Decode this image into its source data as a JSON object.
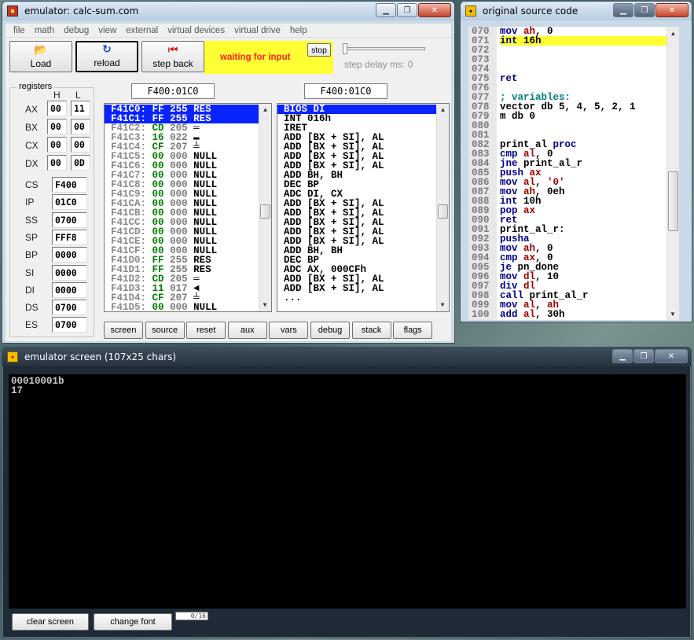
{
  "emulator_window": {
    "title": "emulator: calc-sum.com",
    "menu": [
      "file",
      "math",
      "debug",
      "view",
      "external",
      "virtual devices",
      "virtual drive",
      "help"
    ],
    "toolbar": {
      "load": "Load",
      "reload": "reload",
      "step_back": "step back",
      "status": "waiting for input",
      "stop": "stop",
      "step_delay": "step delay ms: 0"
    },
    "registers": {
      "title": "registers",
      "h": "H",
      "l": "L",
      "split": [
        {
          "name": "AX",
          "h": "00",
          "l": "11"
        },
        {
          "name": "BX",
          "h": "00",
          "l": "00"
        },
        {
          "name": "CX",
          "h": "00",
          "l": "00"
        },
        {
          "name": "DX",
          "h": "00",
          "l": "0D"
        }
      ],
      "full": [
        {
          "name": "CS",
          "value": "F400"
        },
        {
          "name": "IP",
          "value": "01C0"
        },
        {
          "name": "SS",
          "value": "0700"
        },
        {
          "name": "SP",
          "value": "FFF8"
        },
        {
          "name": "BP",
          "value": "0000"
        },
        {
          "name": "SI",
          "value": "0000"
        },
        {
          "name": "DI",
          "value": "0000"
        },
        {
          "name": "DS",
          "value": "0700"
        },
        {
          "name": "ES",
          "value": "0700"
        }
      ]
    },
    "memory_address": "F400:01C0",
    "disasm_address": "F400:01C0",
    "memory": [
      {
        "addr": "F41C0:",
        "hex": "FF",
        "dec": "255",
        "chr": "RES",
        "sel": true
      },
      {
        "addr": "F41C1:",
        "hex": "FF",
        "dec": "255",
        "chr": "RES",
        "sel": true
      },
      {
        "addr": "F41C2:",
        "hex": "CD",
        "dec": "205",
        "chr": "═"
      },
      {
        "addr": "F41C3:",
        "hex": "16",
        "dec": "022",
        "chr": "▬"
      },
      {
        "addr": "F41C4:",
        "hex": "CF",
        "dec": "207",
        "chr": "╧"
      },
      {
        "addr": "F41C5:",
        "hex": "00",
        "dec": "000",
        "chr": "NULL"
      },
      {
        "addr": "F41C6:",
        "hex": "00",
        "dec": "000",
        "chr": "NULL"
      },
      {
        "addr": "F41C7:",
        "hex": "00",
        "dec": "000",
        "chr": "NULL"
      },
      {
        "addr": "F41C8:",
        "hex": "00",
        "dec": "000",
        "chr": "NULL"
      },
      {
        "addr": "F41C9:",
        "hex": "00",
        "dec": "000",
        "chr": "NULL"
      },
      {
        "addr": "F41CA:",
        "hex": "00",
        "dec": "000",
        "chr": "NULL"
      },
      {
        "addr": "F41CB:",
        "hex": "00",
        "dec": "000",
        "chr": "NULL"
      },
      {
        "addr": "F41CC:",
        "hex": "00",
        "dec": "000",
        "chr": "NULL"
      },
      {
        "addr": "F41CD:",
        "hex": "00",
        "dec": "000",
        "chr": "NULL"
      },
      {
        "addr": "F41CE:",
        "hex": "00",
        "dec": "000",
        "chr": "NULL"
      },
      {
        "addr": "F41CF:",
        "hex": "00",
        "dec": "000",
        "chr": "NULL"
      },
      {
        "addr": "F41D0:",
        "hex": "FF",
        "dec": "255",
        "chr": "RES"
      },
      {
        "addr": "F41D1:",
        "hex": "FF",
        "dec": "255",
        "chr": "RES"
      },
      {
        "addr": "F41D2:",
        "hex": "CD",
        "dec": "205",
        "chr": "═"
      },
      {
        "addr": "F41D3:",
        "hex": "11",
        "dec": "017",
        "chr": "◄"
      },
      {
        "addr": "F41D4:",
        "hex": "CF",
        "dec": "207",
        "chr": "╧"
      },
      {
        "addr": "F41D5:",
        "hex": "00",
        "dec": "000",
        "chr": "NULL"
      }
    ],
    "disasm": [
      {
        "text": "BIOS DI",
        "sel": true
      },
      {
        "text": "INT 016h"
      },
      {
        "text": "IRET"
      },
      {
        "text": "ADD [BX + SI], AL"
      },
      {
        "text": "ADD [BX + SI], AL"
      },
      {
        "text": "ADD [BX + SI], AL"
      },
      {
        "text": "ADD [BX + SI], AL"
      },
      {
        "text": "ADD BH, BH"
      },
      {
        "text": "DEC BP"
      },
      {
        "text": "ADC DI, CX"
      },
      {
        "text": "ADD [BX + SI], AL"
      },
      {
        "text": "ADD [BX + SI], AL"
      },
      {
        "text": "ADD [BX + SI], AL"
      },
      {
        "text": "ADD [BX + SI], AL"
      },
      {
        "text": "ADD [BX + SI], AL"
      },
      {
        "text": "ADD BH, BH"
      },
      {
        "text": "DEC BP"
      },
      {
        "text": "ADC AX, 000CFh"
      },
      {
        "text": "ADD [BX + SI], AL"
      },
      {
        "text": "ADD [BX + SI], AL"
      },
      {
        "text": "..."
      }
    ],
    "bottom_buttons": [
      "screen",
      "source",
      "reset",
      "aux",
      "vars",
      "debug",
      "stack",
      "flags"
    ]
  },
  "source_window": {
    "title": "original source code",
    "lines": [
      {
        "n": "070",
        "parts": [
          [
            "kw",
            "mov "
          ],
          [
            "rg",
            "ah"
          ],
          [
            "nm",
            ", 0"
          ]
        ]
      },
      {
        "n": "071",
        "parts": [
          [
            "kw",
            "int "
          ],
          [
            "nm",
            "16h"
          ]
        ],
        "hl": true
      },
      {
        "n": "072",
        "parts": []
      },
      {
        "n": "073",
        "parts": []
      },
      {
        "n": "074",
        "parts": []
      },
      {
        "n": "075",
        "parts": [
          [
            "kw",
            "ret"
          ]
        ]
      },
      {
        "n": "076",
        "parts": []
      },
      {
        "n": "077",
        "parts": [
          [
            "cm",
            "; variables:"
          ]
        ]
      },
      {
        "n": "078",
        "parts": [
          [
            "nm",
            "vector db 5, 4, 5, 2, 1"
          ]
        ]
      },
      {
        "n": "079",
        "parts": [
          [
            "nm",
            "m db 0"
          ]
        ]
      },
      {
        "n": "080",
        "parts": []
      },
      {
        "n": "081",
        "parts": []
      },
      {
        "n": "082",
        "parts": [
          [
            "nm",
            "print_al "
          ],
          [
            "kw",
            "proc"
          ]
        ]
      },
      {
        "n": "083",
        "parts": [
          [
            "kw",
            "cmp "
          ],
          [
            "rg",
            "al"
          ],
          [
            "nm",
            ", 0"
          ]
        ]
      },
      {
        "n": "084",
        "parts": [
          [
            "kw",
            "jne "
          ],
          [
            "nm",
            "print_al_r"
          ]
        ]
      },
      {
        "n": "085",
        "parts": [
          [
            "kw",
            "push "
          ],
          [
            "rg",
            "ax"
          ]
        ]
      },
      {
        "n": "086",
        "parts": [
          [
            "kw",
            "mov "
          ],
          [
            "rg",
            "al"
          ],
          [
            "nm",
            ", "
          ],
          [
            "st",
            "'0'"
          ]
        ]
      },
      {
        "n": "087",
        "parts": [
          [
            "kw",
            "mov "
          ],
          [
            "rg",
            "ah"
          ],
          [
            "nm",
            ", 0eh"
          ]
        ]
      },
      {
        "n": "088",
        "parts": [
          [
            "kw",
            "int "
          ],
          [
            "nm",
            "10h"
          ]
        ]
      },
      {
        "n": "089",
        "parts": [
          [
            "kw",
            "pop "
          ],
          [
            "rg",
            "ax"
          ]
        ]
      },
      {
        "n": "090",
        "parts": [
          [
            "kw",
            "ret"
          ]
        ]
      },
      {
        "n": "091",
        "parts": [
          [
            "nm",
            "print_al_r:"
          ]
        ]
      },
      {
        "n": "092",
        "parts": [
          [
            "kw",
            "pusha"
          ]
        ]
      },
      {
        "n": "093",
        "parts": [
          [
            "kw",
            "mov "
          ],
          [
            "rg",
            "ah"
          ],
          [
            "nm",
            ", 0"
          ]
        ]
      },
      {
        "n": "094",
        "parts": [
          [
            "kw",
            "cmp "
          ],
          [
            "rg",
            "ax"
          ],
          [
            "nm",
            ", 0"
          ]
        ]
      },
      {
        "n": "095",
        "parts": [
          [
            "kw",
            "je "
          ],
          [
            "nm",
            "pn_done"
          ]
        ]
      },
      {
        "n": "096",
        "parts": [
          [
            "kw",
            "mov "
          ],
          [
            "rg",
            "dl"
          ],
          [
            "nm",
            ", 10"
          ]
        ]
      },
      {
        "n": "097",
        "parts": [
          [
            "kw",
            "div "
          ],
          [
            "rg",
            "dl"
          ]
        ]
      },
      {
        "n": "098",
        "parts": [
          [
            "kw",
            "call "
          ],
          [
            "nm",
            "print_al_r"
          ]
        ]
      },
      {
        "n": "099",
        "parts": [
          [
            "kw",
            "mov "
          ],
          [
            "rg",
            "al"
          ],
          [
            "nm",
            ", "
          ],
          [
            "rg",
            "ah"
          ]
        ]
      },
      {
        "n": "100",
        "parts": [
          [
            "kw",
            "add "
          ],
          [
            "rg",
            "al"
          ],
          [
            "nm",
            ", 30h"
          ]
        ]
      }
    ]
  },
  "screen_window": {
    "title": "emulator screen (107x25 chars)",
    "lines": [
      "00010001b",
      "17"
    ],
    "clear_screen": "clear screen",
    "change_font": "change font",
    "counter": "0/16"
  },
  "colors": {
    "selection": "#0a24ff",
    "status_bg": "#ffff33",
    "status_text": "#ff2020",
    "hex_green": "#008000"
  }
}
